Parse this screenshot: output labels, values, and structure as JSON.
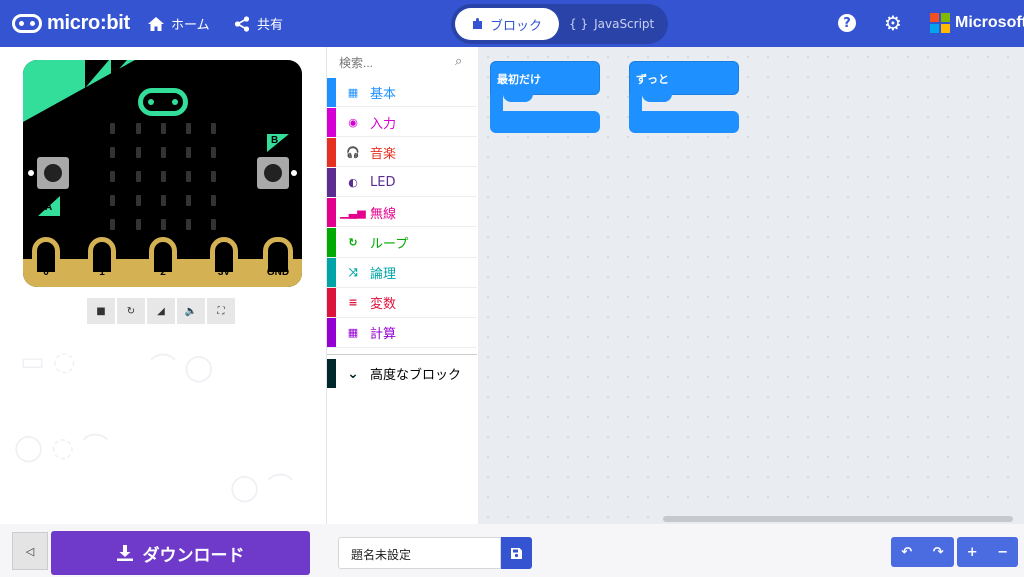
{
  "header": {
    "logo_text": "micro:bit",
    "nav": [
      {
        "icon": "home-icon",
        "label": "ホーム"
      },
      {
        "icon": "share-icon",
        "label": "共有"
      }
    ],
    "editor_toggle": {
      "blocks_label": "ブロック",
      "js_label": "JavaScript",
      "js_braces": "{ }"
    },
    "help_glyph": "?",
    "brand": "Microsoft",
    "brand_colors": [
      "#f25022",
      "#7fba00",
      "#00a4ef",
      "#ffb900"
    ],
    "accent": "#3454d1"
  },
  "simulator": {
    "button_a": "A",
    "button_b": "B",
    "pins": [
      "0",
      "1",
      "2",
      "3V",
      "GND"
    ],
    "toolbar": [
      {
        "name": "stop-icon",
        "glyph": "■"
      },
      {
        "name": "restart-icon",
        "glyph": "↻"
      },
      {
        "name": "slow-motion-icon",
        "glyph": "◢"
      },
      {
        "name": "sound-icon",
        "glyph": "🔈"
      },
      {
        "name": "fullscreen-icon",
        "glyph": "⛶"
      }
    ]
  },
  "toolbox": {
    "search_placeholder": "検索...",
    "categories": [
      {
        "label": "基本",
        "color": "#1e90ff",
        "glyph": "▦"
      },
      {
        "label": "入力",
        "color": "#d400d4",
        "glyph": "◉"
      },
      {
        "label": "音楽",
        "color": "#e63022",
        "glyph": "🎧"
      },
      {
        "label": "LED",
        "color": "#5c2d91",
        "glyph": "◐"
      },
      {
        "label": "無線",
        "color": "#e3008c",
        "glyph": "▁▃▅"
      },
      {
        "label": "ループ",
        "color": "#00aa00",
        "glyph": "↻"
      },
      {
        "label": "論理",
        "color": "#00a4a6",
        "glyph": "⤨"
      },
      {
        "label": "変数",
        "color": "#dc143c",
        "glyph": "≡"
      },
      {
        "label": "計算",
        "color": "#9400d3",
        "glyph": "▦"
      }
    ],
    "advanced": {
      "label": "高度なブロック",
      "color": "#00272b",
      "glyph": "⌄"
    }
  },
  "workspace": {
    "blocks": [
      {
        "label": "最初だけ"
      },
      {
        "label": "ずっと"
      }
    ]
  },
  "bottom_bar": {
    "download_label": "ダウンロード",
    "download_color": "#6f3ac9",
    "project_name": "題名未設定",
    "undo_glyph": "↶",
    "redo_glyph": "↷",
    "zoom_in_glyph": "+",
    "zoom_out_glyph": "−"
  }
}
